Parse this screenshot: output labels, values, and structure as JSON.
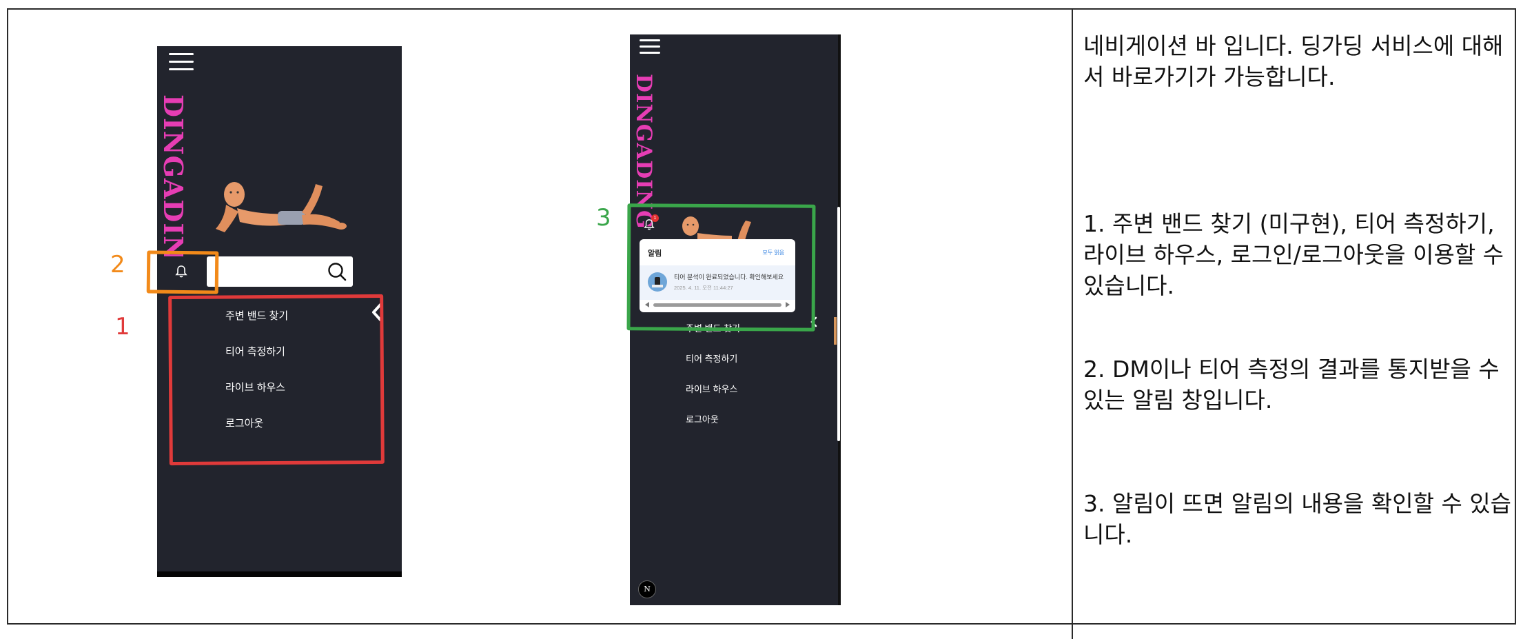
{
  "colors": {
    "phone_bg": "#22242d",
    "brand_pink": "#e63db4",
    "annotation_red": "#e03a3a",
    "annotation_orange": "#f28a1a",
    "annotation_green": "#3aa64a"
  },
  "screen1": {
    "brand": "DINGADING",
    "menu": [
      "주변 밴드 찾기",
      "티어 측정하기",
      "라이브 하우스",
      "로그아웃"
    ],
    "search": {
      "placeholder": ""
    }
  },
  "screen2": {
    "brand": "DINGADING",
    "badge_count": "1",
    "notification": {
      "title": "알림",
      "read_all": "모두 읽음",
      "message": "티어 분석이 완료되었습니다. 확인해보세요",
      "time": "2025. 4. 11. 오전 11:44:27"
    },
    "menu": [
      "주변 밴드 찾기",
      "티어 측정하기",
      "라이브 하우스",
      "로그아웃"
    ],
    "corner_logo": "N"
  },
  "annotations": {
    "label_1": "1",
    "label_2": "2",
    "label_3": "3"
  },
  "descriptions": [
    "네비게이션 바 입니다. 딩가딩 서비스에 대해서 바로가기가 가능합니다.",
    "1. 주변 밴드 찾기 (미구현), 티어 측정하기, 라이브 하우스, 로그인/로그아웃을 이용할 수 있습니다.",
    "2. DM이나 티어 측정의 결과를 통지받을 수 있는 알림 창입니다.",
    "3. 알림이 뜨면 알림의 내용을 확인할 수 있습니다."
  ]
}
